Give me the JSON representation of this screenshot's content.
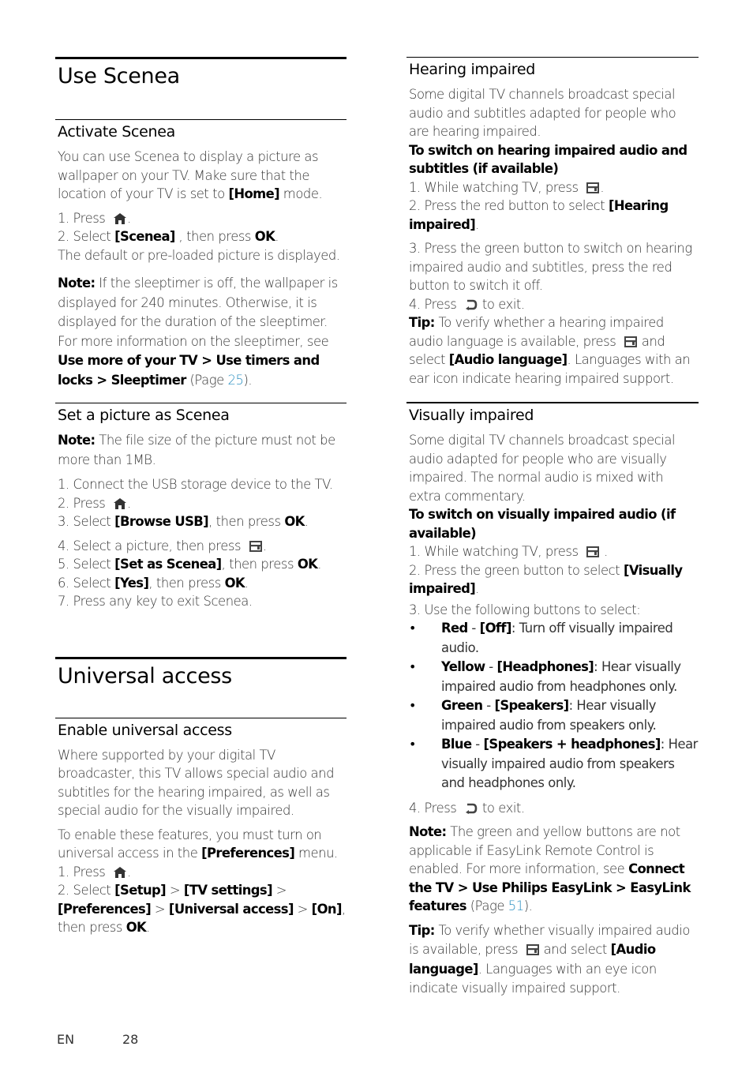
{
  "left": {
    "use_scenea": {
      "title": "Use Scenea",
      "activate": {
        "heading": "Activate Scenea",
        "intro": [
          "You can use Scenea to display a picture as wallpaper on your TV. Make sure that the location of your TV is set to ",
          "[Home]",
          " mode."
        ],
        "step1": [
          "1. Press ",
          "."
        ],
        "step2": [
          "2. Select ",
          "[Scenea]",
          " , then press ",
          "OK",
          "."
        ],
        "result": "The default or pre-loaded picture is displayed.",
        "note_label": "Note:",
        "note_text": " If the sleeptimer is off, the wallpaper is displayed for 240 minutes. Otherwise, it is displayed for the duration of the sleeptimer. For more information on the sleeptimer, see ",
        "note_ref": "Use more of your TV > Use timers and locks > Sleeptimer",
        "note_page_prefix": " (Page ",
        "note_page": "25",
        "note_page_suffix": ")."
      },
      "set_picture": {
        "heading": "Set a picture as Scenea",
        "note_label": "Note:",
        "note_text": " The file size of the picture must not be more than 1MB.",
        "step1": "1. Connect the USB storage device to the TV.",
        "step2": [
          "2. Press ",
          "."
        ],
        "step3": [
          "3. Select ",
          "[Browse USB]",
          ", then press ",
          "OK",
          "."
        ],
        "step4": [
          "4. Select a picture, then press ",
          "."
        ],
        "step5": [
          "5. Select ",
          "[Set as Scenea]",
          ", then press ",
          "OK",
          "."
        ],
        "step6": [
          "6. Select ",
          "[Yes]",
          ", then press ",
          "OK",
          "."
        ],
        "step7": "7. Press any key to exit Scenea."
      }
    },
    "universal_access": {
      "title": "Universal access",
      "enable": {
        "heading": "Enable universal access",
        "intro": "Where supported by your digital TV broadcaster, this TV allows special audio and subtitles for the hearing impaired, as well as special audio for the visually impaired.",
        "enable_text": [
          "To enable these features, you must turn on universal access in the ",
          "[Preferences]",
          " menu."
        ],
        "step1": [
          "1. Press ",
          "."
        ],
        "step2": [
          "2. Select ",
          "[Setup]",
          " > ",
          "[TV settings]",
          " > ",
          "[Preferences]",
          " > ",
          "[Universal access]",
          " > ",
          "[On]",
          ", then press ",
          "OK",
          "."
        ]
      }
    }
  },
  "right": {
    "hearing": {
      "heading": "Hearing impaired",
      "intro": "Some digital TV channels broadcast special audio and subtitles adapted for people who are hearing impaired.",
      "subhead": "To switch on hearing impaired audio and subtitles (if available)",
      "step1": [
        "1. While watching TV, press ",
        "."
      ],
      "step2": [
        "2. Press the red button to select ",
        "[Hearing impaired]",
        "."
      ],
      "step3": "3. Press the green button to switch on hearing impaired audio and subtitles, press the red button to switch it off.",
      "step4": [
        "4. Press ",
        " to exit."
      ],
      "tip_label": "Tip:",
      "tip_text1": " To verify whether a hearing impaired audio language is available, press ",
      "tip_text2": " and select ",
      "tip_ref": "[Audio language]",
      "tip_text3": ". Languages with an ear icon indicate hearing impaired support."
    },
    "visual": {
      "heading": "Visually impaired",
      "intro": "Some digital TV channels broadcast special audio adapted for people who are visually impaired. The normal audio is mixed with extra commentary.",
      "subhead": "To switch on visually impaired audio (if available)",
      "step1": [
        "1. While watching TV, press ",
        " ."
      ],
      "step2": [
        "2. Press the green button to select ",
        "[Visually impaired]",
        "."
      ],
      "step3": "3. Use the following buttons to select:",
      "bullets": [
        {
          "color": "Red",
          "sep": " - ",
          "option": "[Off]",
          "desc": ": Turn off visually impaired audio."
        },
        {
          "color": "Yellow",
          "sep": " - ",
          "option": "[Headphones]",
          "desc": ": Hear visually impaired audio from headphones only."
        },
        {
          "color": "Green",
          "sep": " - ",
          "option": "[Speakers]",
          "desc": ": Hear visually impaired audio from speakers only."
        },
        {
          "color": "Blue",
          "sep": " - ",
          "option": "[Speakers + headphones]",
          "desc": ": Hear visually impaired audio from speakers and headphones only."
        }
      ],
      "bullet_glyph": "•",
      "step4": [
        "4. Press ",
        " to exit."
      ],
      "note_label": "Note:",
      "note_text": " The green and yellow buttons are not applicable if EasyLink Remote Control is enabled. For more information, see ",
      "note_ref": "Connect the TV > Use Philips EasyLink > EasyLink features",
      "note_page_prefix": " (Page ",
      "note_page": "51",
      "note_page_suffix": ").",
      "tip_label": "Tip:",
      "tip_text1": " To verify whether visually impaired audio is available, press ",
      "tip_text2": " and select ",
      "tip_ref": "[Audio language]",
      "tip_text3": ". Languages with an eye icon indicate visually impaired support."
    }
  },
  "footer": {
    "language": "EN",
    "page_number": "28"
  },
  "icons": {
    "home": "home-icon",
    "options": "options-icon",
    "back": "back-icon"
  },
  "colors": {
    "link": "#2a8fc1",
    "text": "#333333",
    "heading": "#000000"
  }
}
